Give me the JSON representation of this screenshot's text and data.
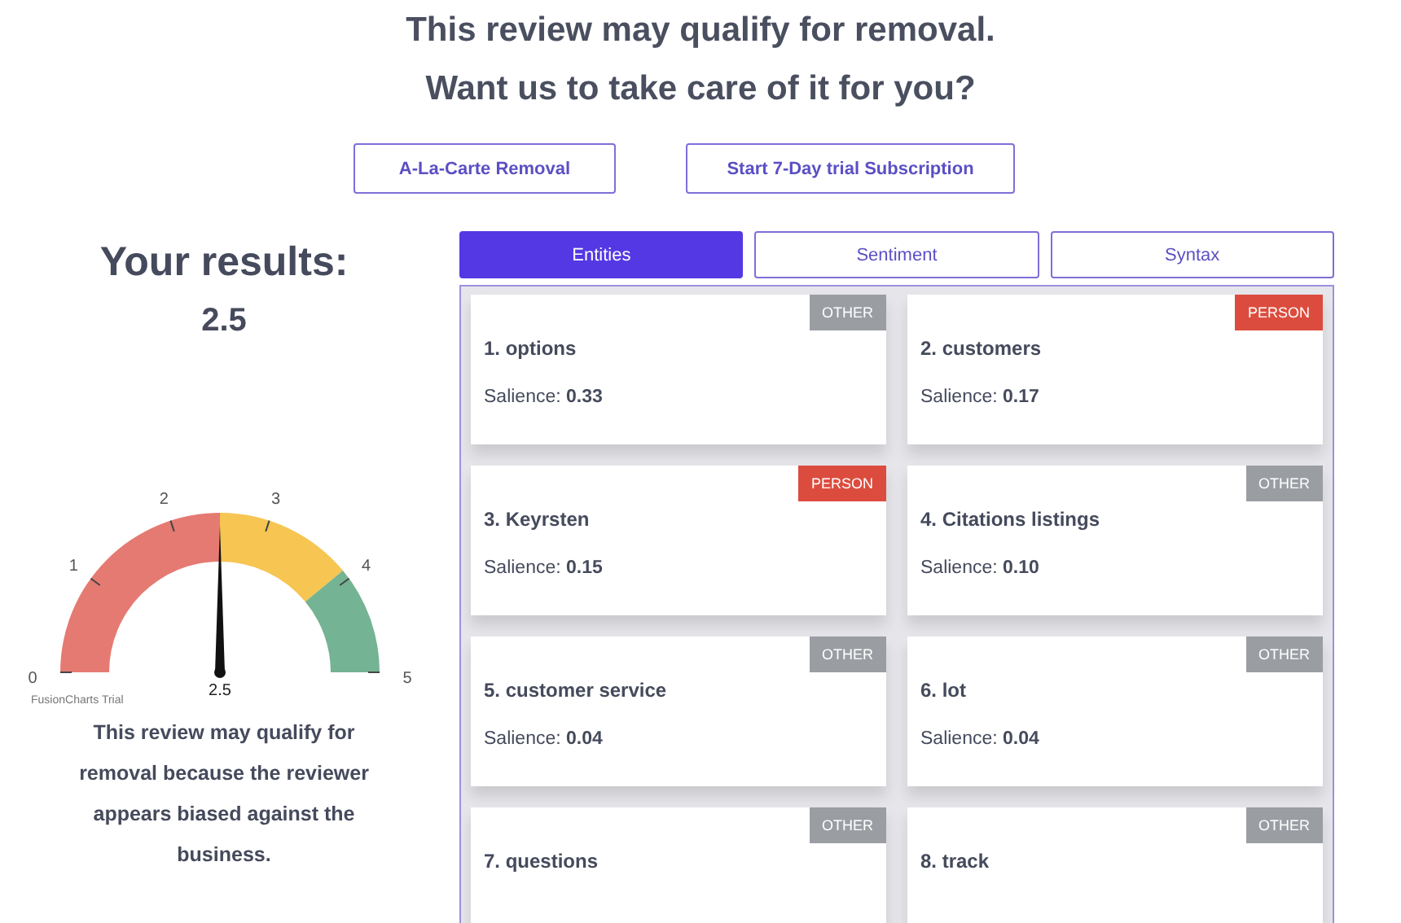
{
  "heading": [
    "This review may qualify for removal.",
    "Want us to take care of it for you?"
  ],
  "actions": [
    "A-La-Carte Removal",
    "Start 7-Day trial Subscription"
  ],
  "results": {
    "title": "Your results:",
    "score": "2.5"
  },
  "gauge": {
    "ticks": [
      "0",
      "1",
      "2",
      "3",
      "4",
      "5"
    ],
    "value": "2.5",
    "level": 0.5,
    "credit": "FusionCharts Trial"
  },
  "verdict": "This review may qualify for removal because the reviewer appears biased against the business.",
  "tabs": [
    {
      "label": "Entities",
      "selected": true
    },
    {
      "label": "Sentiment",
      "selected": false
    },
    {
      "label": "Syntax",
      "selected": false
    }
  ],
  "entities": [
    {
      "name": "1. options",
      "type": "OTHER",
      "color": "#9a9ea3",
      "salience_label": "Salience:",
      "salience": "0.33"
    },
    {
      "name": "2. customers",
      "type": "PERSON",
      "color": "#dc4c3e",
      "salience_label": "Salience:",
      "salience": "0.17"
    },
    {
      "name": "3. Keyrsten",
      "type": "PERSON",
      "color": "#dc4c3e",
      "salience_label": "Salience:",
      "salience": "0.15"
    },
    {
      "name": "4. Citations listings",
      "type": "OTHER",
      "color": "#9a9ea3",
      "salience_label": "Salience:",
      "salience": "0.10"
    },
    {
      "name": "5. customer service",
      "type": "OTHER",
      "color": "#9a9ea3",
      "salience_label": "Salience:",
      "salience": "0.04"
    },
    {
      "name": "6. lot",
      "type": "OTHER",
      "color": "#9a9ea3",
      "salience_label": "Salience:",
      "salience": "0.04"
    },
    {
      "name": "7. questions",
      "type": "OTHER",
      "color": "#9a9ea3"
    },
    {
      "name": "8. track",
      "type": "OTHER",
      "color": "#9a9ea3"
    }
  ]
}
